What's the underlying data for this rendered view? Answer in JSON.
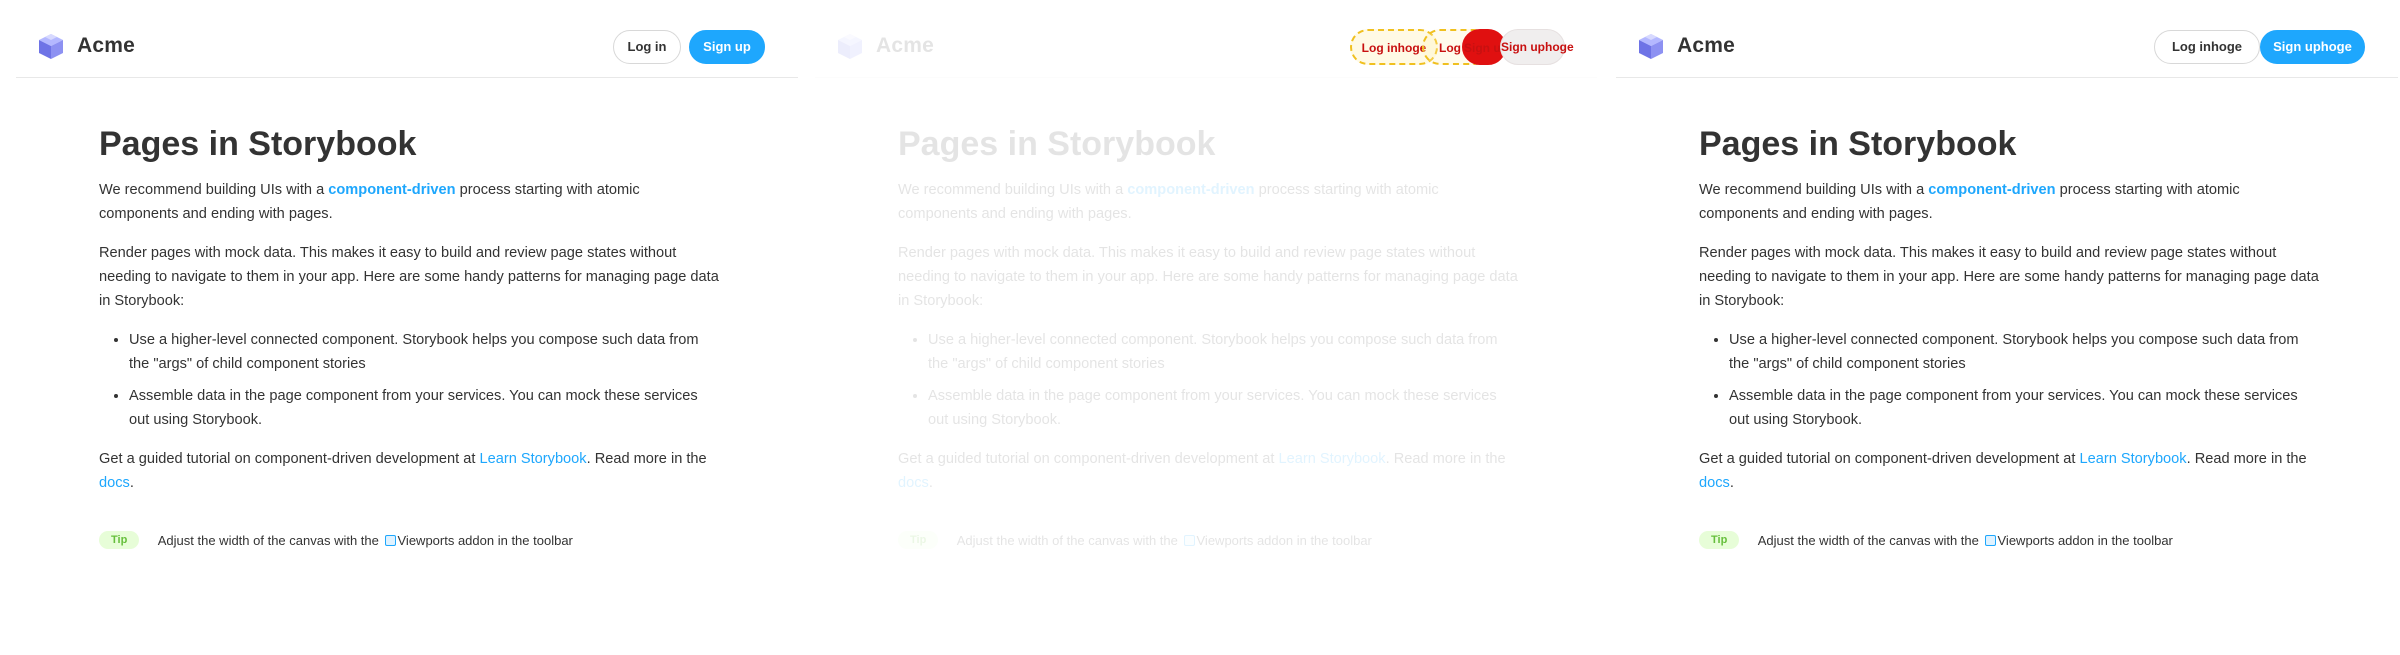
{
  "header": {
    "brand": "Acme",
    "login_label": "Log in",
    "signup_label": "Sign up"
  },
  "header_variant": {
    "login_label": "Log inhoge",
    "signup_label": "Sign uphoge"
  },
  "highlight_overlay": {
    "labels": [
      "Log inhoge",
      "Log in",
      "Sign up",
      "Sign uphoge"
    ]
  },
  "content": {
    "title": "Pages in Storybook",
    "intro_before": "We recommend building UIs with a ",
    "intro_link": "component-driven",
    "intro_after": " process starting with atomic components and ending with pages.",
    "render_paragraph": "Render pages with mock data. This makes it easy to build and review page states without needing to navigate to them in your app. Here are some handy patterns for managing page data in Storybook:",
    "bullets": [
      "Use a higher-level connected component. Storybook helps you compose such data from the \"args\" of child component stories",
      "Assemble data in the page component from your services. You can mock these services out using Storybook."
    ],
    "tutorial_before": "Get a guided tutorial on component-driven development at ",
    "tutorial_link": "Learn Storybook",
    "tutorial_middle": ". Read more in the ",
    "docs_link": "docs",
    "tutorial_end": "."
  },
  "tip": {
    "badge": "Tip",
    "text_before": "Adjust the width of the canvas with the ",
    "text_after": "Viewports addon in the toolbar"
  },
  "colors": {
    "accent": "#1ea7fd",
    "tip_bg": "#e7fdd8",
    "tip_fg": "#66bf3c",
    "highlight_red": "#e01010",
    "highlight_yellow": "#f0c020"
  }
}
